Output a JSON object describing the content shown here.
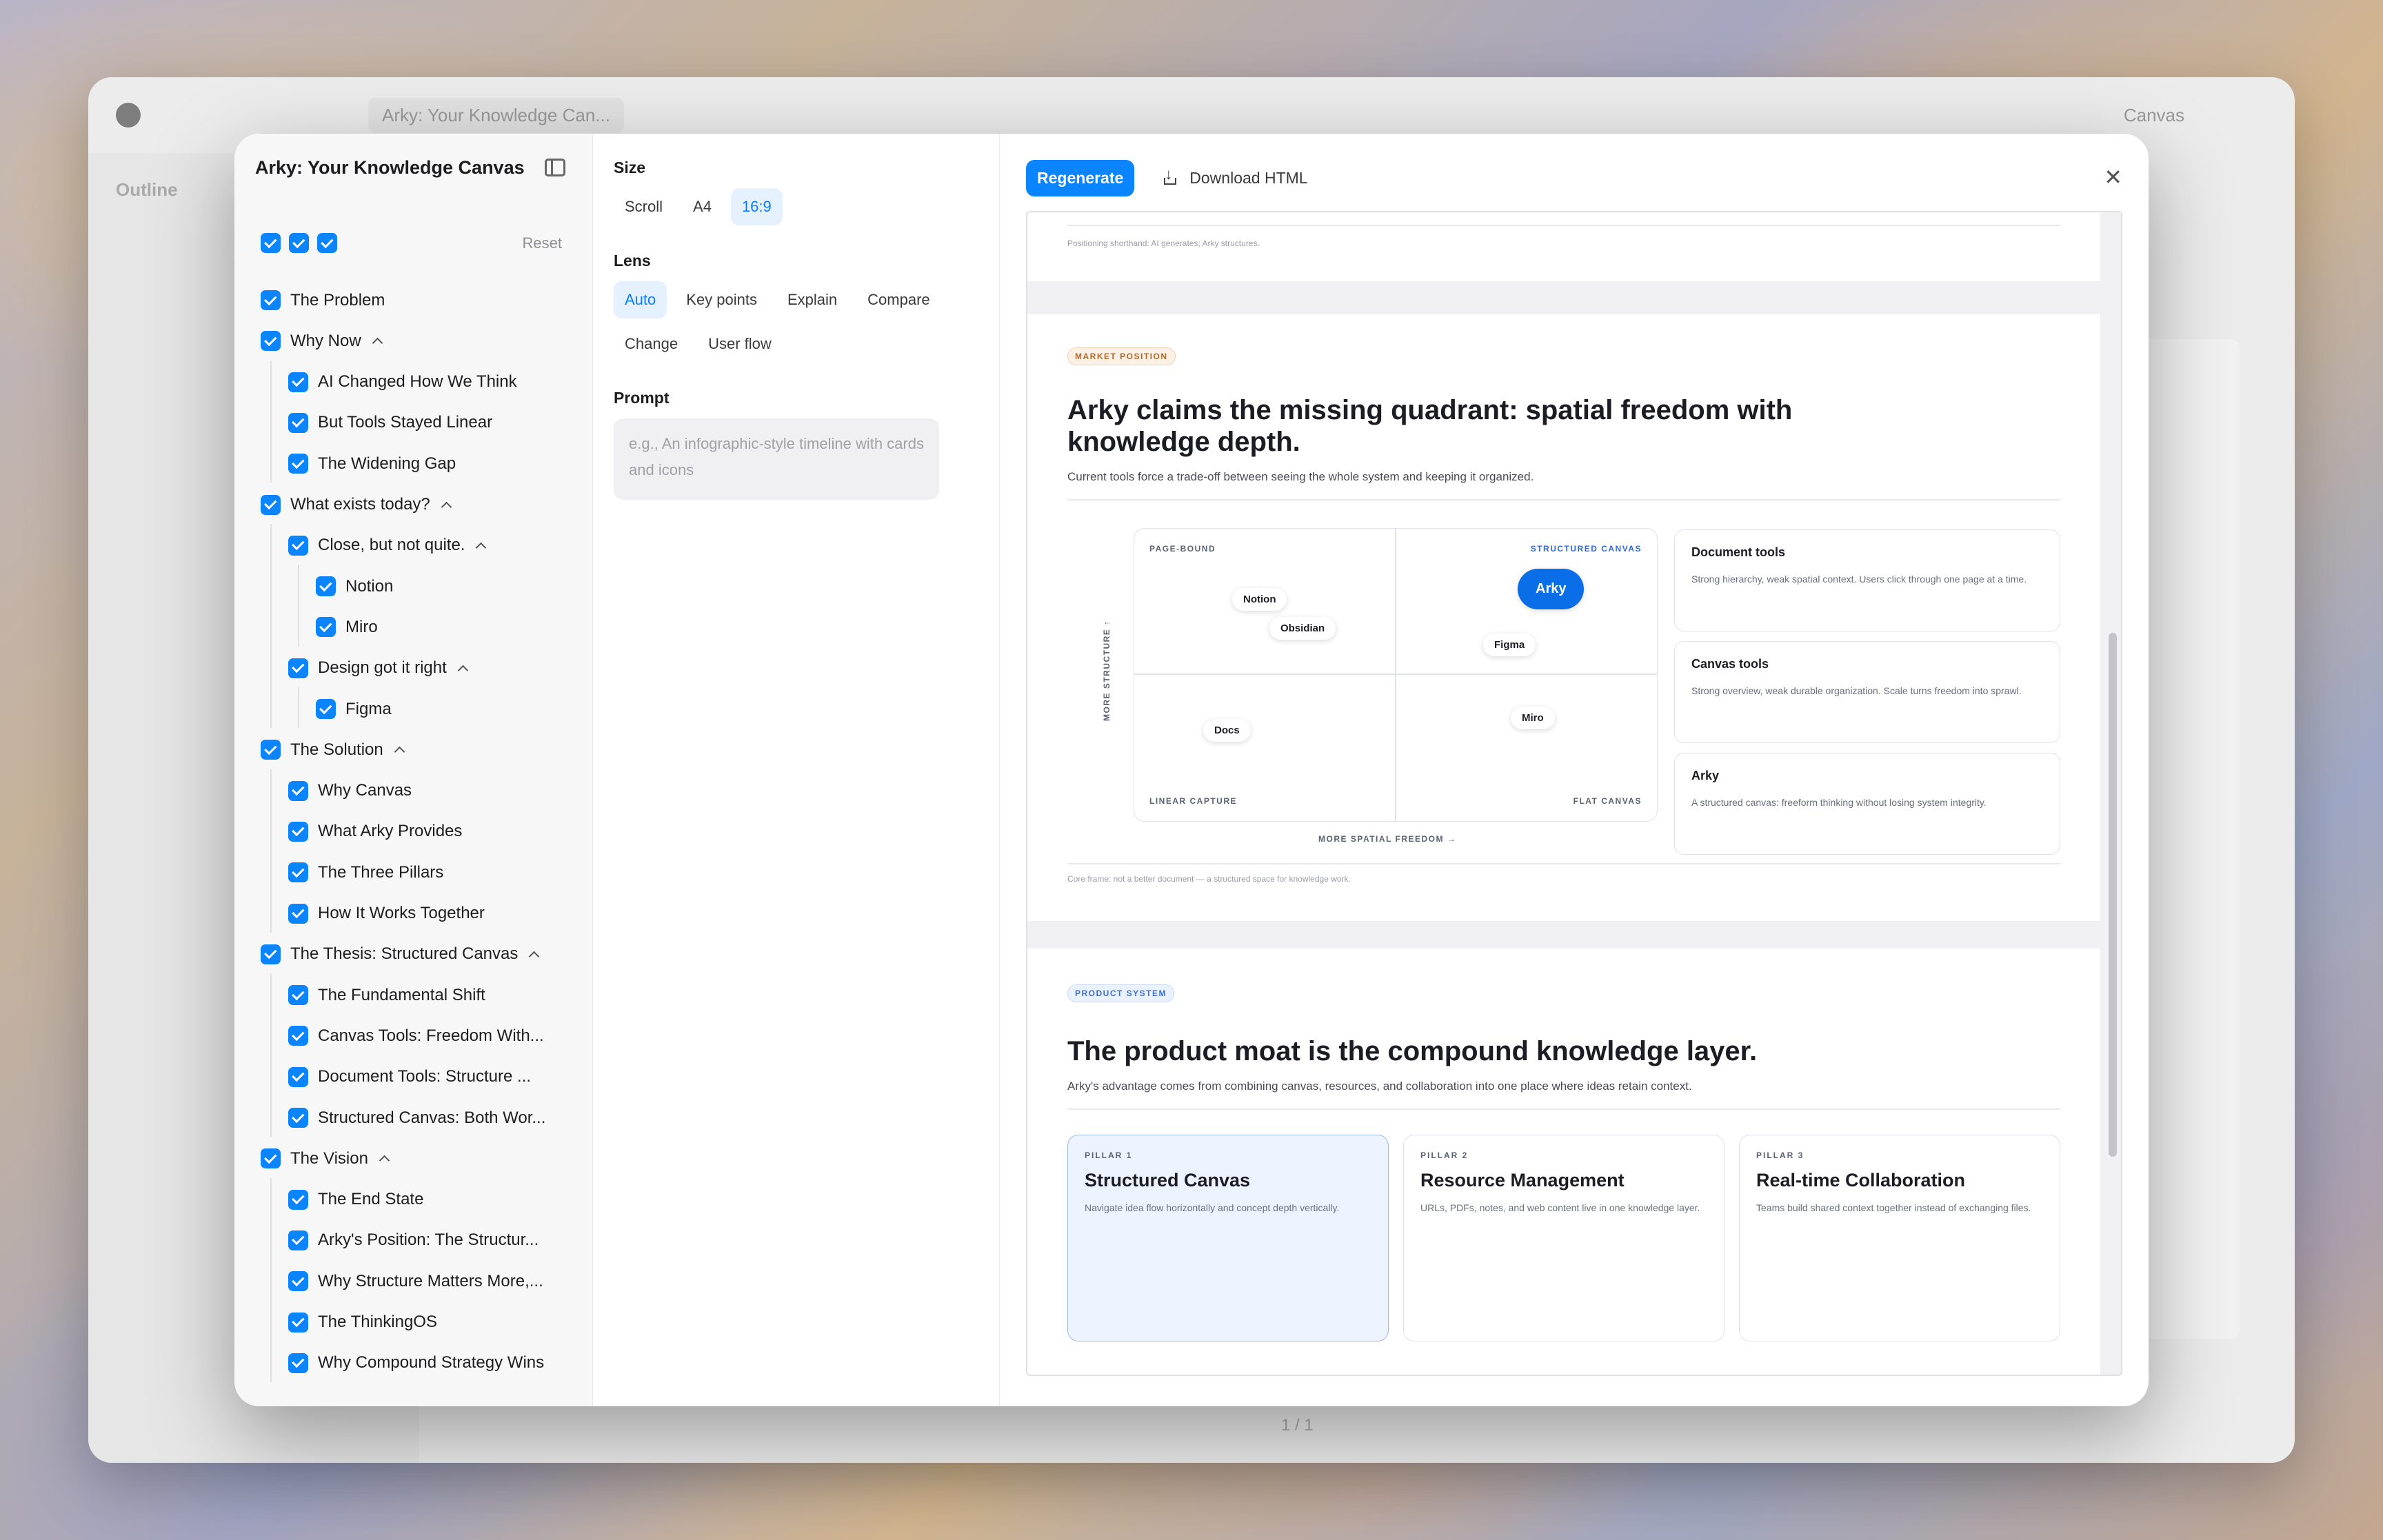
{
  "window": {
    "tab_title": "Arky: Your Knowledge Can...",
    "top_right_label": "Canvas"
  },
  "bg_app": {
    "left_title": "Outline",
    "pager": "1 / 1"
  },
  "outline": {
    "title": "Arky: Your Knowledge Canvas",
    "reset_label": "Reset",
    "items": [
      {
        "label": "The Problem",
        "level": 0,
        "expandable": false
      },
      {
        "label": "Why Now",
        "level": 0,
        "expandable": true
      },
      {
        "label": "AI Changed How We Think",
        "level": 1,
        "expandable": false
      },
      {
        "label": "But Tools Stayed Linear",
        "level": 1,
        "expandable": false
      },
      {
        "label": "The Widening Gap",
        "level": 1,
        "expandable": false
      },
      {
        "label": "What exists today?",
        "level": 0,
        "expandable": true
      },
      {
        "label": "Close, but not quite.",
        "level": 1,
        "expandable": true
      },
      {
        "label": "Notion",
        "level": 2,
        "expandable": false
      },
      {
        "label": "Miro",
        "level": 2,
        "expandable": false
      },
      {
        "label": "Design got it right",
        "level": 1,
        "expandable": true
      },
      {
        "label": "Figma",
        "level": 2,
        "expandable": false
      },
      {
        "label": "The Solution",
        "level": 0,
        "expandable": true
      },
      {
        "label": "Why Canvas",
        "level": 1,
        "expandable": false
      },
      {
        "label": "What Arky Provides",
        "level": 1,
        "expandable": false
      },
      {
        "label": "The Three Pillars",
        "level": 1,
        "expandable": false
      },
      {
        "label": "How It Works Together",
        "level": 1,
        "expandable": false
      },
      {
        "label": "The Thesis: Structured Canvas",
        "level": 0,
        "expandable": true
      },
      {
        "label": "The Fundamental Shift",
        "level": 1,
        "expandable": false
      },
      {
        "label": "Canvas Tools: Freedom With...",
        "level": 1,
        "expandable": false
      },
      {
        "label": "Document Tools: Structure ...",
        "level": 1,
        "expandable": false
      },
      {
        "label": "Structured Canvas: Both Wor...",
        "level": 1,
        "expandable": false
      },
      {
        "label": "The Vision",
        "level": 0,
        "expandable": true
      },
      {
        "label": "The End State",
        "level": 1,
        "expandable": false
      },
      {
        "label": "Arky's Position: The Structur...",
        "level": 1,
        "expandable": false
      },
      {
        "label": "Why Structure Matters More,...",
        "level": 1,
        "expandable": false
      },
      {
        "label": "The ThinkingOS",
        "level": 1,
        "expandable": false
      },
      {
        "label": "Why Compound Strategy Wins",
        "level": 1,
        "expandable": false
      }
    ]
  },
  "settings": {
    "size_label": "Size",
    "size_options": [
      "Scroll",
      "A4",
      "16:9"
    ],
    "size_selected": "16:9",
    "lens_label": "Lens",
    "lens_options": [
      "Auto",
      "Key points",
      "Explain",
      "Compare",
      "Change",
      "User flow"
    ],
    "lens_selected": "Auto",
    "prompt_label": "Prompt",
    "prompt_placeholder": "e.g., An infographic-style timeline with cards and icons"
  },
  "toolbar": {
    "regenerate_label": "Regenerate",
    "download_label": "Download HTML",
    "close_icon": "close-icon"
  },
  "slide0": {
    "footnote": "Positioning shorthand: AI generates; Arky structures."
  },
  "slide1": {
    "tag": "MARKET POSITION",
    "title": "Arky claims the missing quadrant: spatial freedom with knowledge depth.",
    "subtitle": "Current tools force a trade-off between seeing the whole system and keeping it organized.",
    "quadrants": {
      "top_left": "PAGE-BOUND",
      "top_right": "STRUCTURED CANVAS",
      "bottom_left": "LINEAR CAPTURE",
      "bottom_right": "FLAT CANVAS"
    },
    "y_axis": "MORE STRUCTURE ↑",
    "x_axis": "MORE SPATIAL FREEDOM →",
    "products": [
      "Notion",
      "Obsidian",
      "Arky",
      "Figma",
      "Docs",
      "Miro"
    ],
    "cards": [
      {
        "title": "Document tools",
        "desc": "Strong hierarchy, weak spatial context. Users click through one page at a time."
      },
      {
        "title": "Canvas tools",
        "desc": "Strong overview, weak durable organization. Scale turns freedom into sprawl."
      },
      {
        "title": "Arky",
        "desc": "A structured canvas: freeform thinking without losing system integrity."
      }
    ],
    "footnote": "Core frame: not a better document — a structured space for knowledge work."
  },
  "slide2": {
    "tag": "PRODUCT SYSTEM",
    "title": "The product moat is the compound knowledge layer.",
    "subtitle": "Arky's advantage comes from combining canvas, resources, and collaboration into one place where ideas retain context.",
    "pillars": [
      {
        "kicker": "PILLAR 1",
        "title": "Structured Canvas",
        "desc": "Navigate idea flow horizontally and concept depth vertically."
      },
      {
        "kicker": "PILLAR 2",
        "title": "Resource Management",
        "desc": "URLs, PDFs, notes, and web content live in one knowledge layer."
      },
      {
        "kicker": "PILLAR 3",
        "title": "Real-time Collaboration",
        "desc": "Teams build shared context together instead of exchanging files."
      }
    ]
  },
  "colors": {
    "accent": "#0a84ff",
    "arky_pill": "#0a6ee8",
    "tag_orange": "#b4672a",
    "tag_blue": "#3d6fd6"
  }
}
